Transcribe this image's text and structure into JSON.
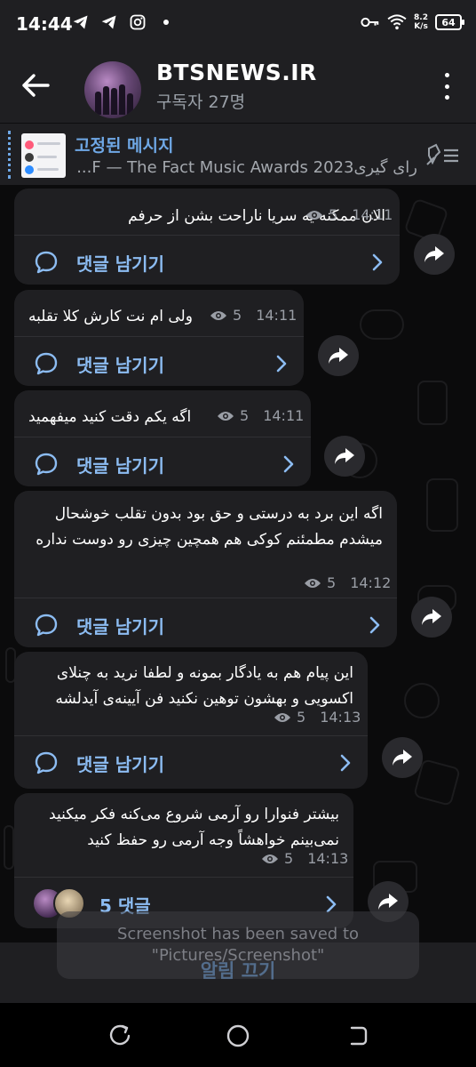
{
  "status_bar": {
    "time": "14:44",
    "net_speed_value": "8.2",
    "net_speed_unit": "K/s",
    "battery": "64",
    "icons": [
      "telegram-icon",
      "telegram-icon",
      "instagram-icon",
      "dot-icon",
      "key-icon",
      "wifi-icon",
      "battery-icon"
    ]
  },
  "header": {
    "title": "BTSNEWS.IR",
    "subtitle": "구독자 27명"
  },
  "pinned": {
    "title": "고정된 메시지",
    "text": "رای گیریF — The Fact Music Awards 2023..."
  },
  "messages": [
    {
      "text": "الان ممکنه یه سریا ناراحت بشن از حرفم",
      "views": "5",
      "time": "14:11",
      "comment_label": "댓글 남기기"
    },
    {
      "text": "ولی ام نت کارش کلا تقلبه",
      "views": "5",
      "time": "14:11",
      "comment_label": "댓글 남기기"
    },
    {
      "text": "اگه یکم دقت کنید میفهمید",
      "views": "5",
      "time": "14:11",
      "comment_label": "댓글 남기기"
    },
    {
      "text": "اگه این برد به درستی و حق بود بدون تقلب خوشحال میشدم مطمئنم کوکی هم همچین چیزی رو دوست نداره",
      "views": "5",
      "time": "14:12",
      "comment_label": "댓글 남기기"
    },
    {
      "text": "این پیام هم به یادگار بمونه و لطفا نرید به چنلای اکسویی و بهشون توهین نکنید فن آیینه‌ی آیدلشه",
      "views": "5",
      "time": "14:13",
      "comment_label": "댓글 남기기"
    },
    {
      "text": "بیشتر فنوارا رو آرمی شروع می‌کنه فکر میکنید نمی‌بینم خواهشاً وجه آرمی رو حفظ کنید",
      "views": "5",
      "time": "14:13",
      "comment_label": "5 댓글"
    }
  ],
  "toast": {
    "text": "Screenshot has been saved to \"Pictures/Screenshot\""
  },
  "footer": {
    "mute_label": "알림 끄기"
  },
  "colors": {
    "accent": "#6fa8e6",
    "bubble": "#1f1f22",
    "background": "#0b0b0c",
    "comment_link": "#8cbcf2"
  }
}
